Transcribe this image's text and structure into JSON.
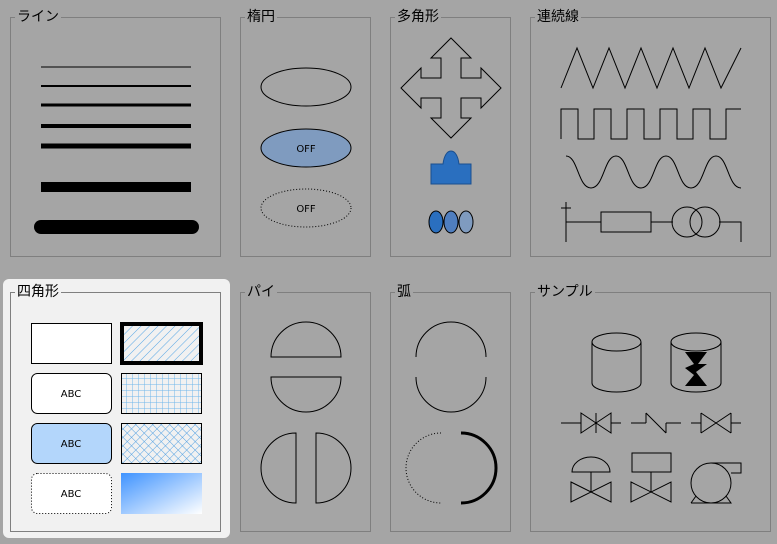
{
  "groups": {
    "line": {
      "title": "ライン"
    },
    "ellipse": {
      "title": "楕円"
    },
    "polygon": {
      "title": "多角形"
    },
    "polyline": {
      "title": "連続線"
    },
    "rectangle": {
      "title": "四角形"
    },
    "pie": {
      "title": "パイ"
    },
    "arc": {
      "title": "弧"
    },
    "sample": {
      "title": "サンプル"
    }
  },
  "ellipse_labels": {
    "off1": "OFF",
    "off2": "OFF"
  },
  "rect_labels": {
    "abc1": "ABC",
    "abc2": "ABC",
    "abc3": "ABC"
  },
  "colors": {
    "background": "#a5a5a5",
    "accent_blue": "#2a6fbf",
    "light_blue": "#b3d6fb",
    "steel_blue": "#7f9bbf"
  }
}
